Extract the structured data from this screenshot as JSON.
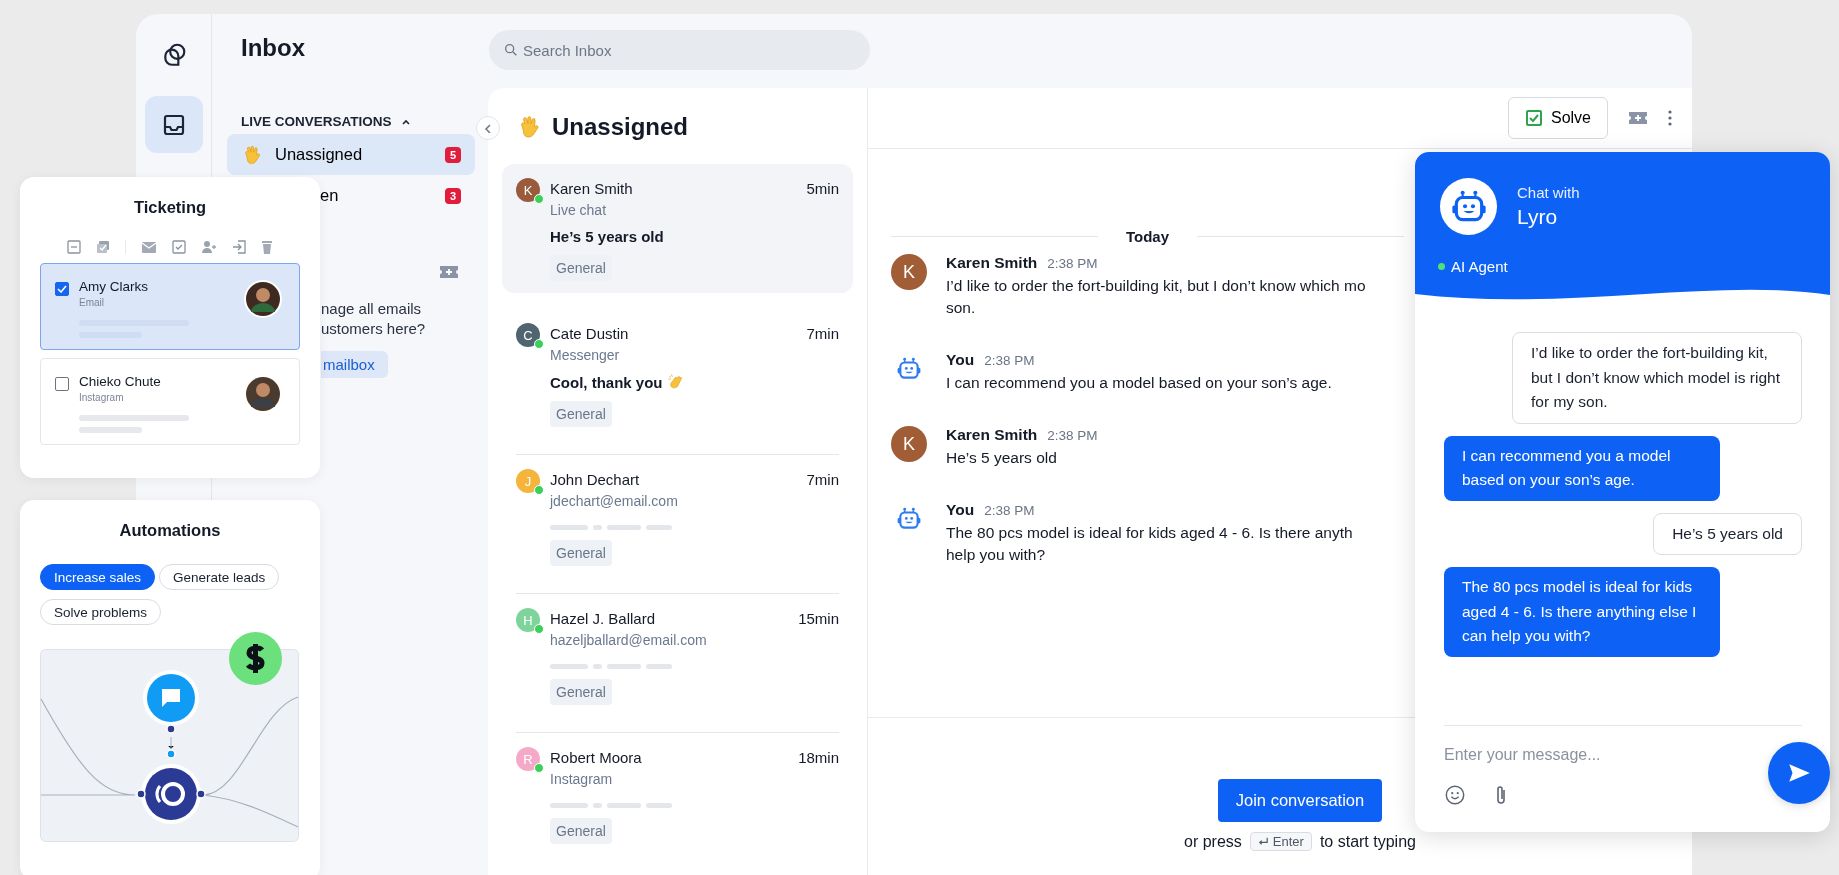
{
  "nav_rail": {
    "items": [
      {
        "kind": "logo",
        "selected": false
      },
      {
        "kind": "inbox",
        "selected": true
      }
    ]
  },
  "inbox_panel": {
    "title": "Inbox",
    "section": {
      "title": "LIVE CONVERSATIONS",
      "expanded": true
    },
    "folders": [
      {
        "kind": "emoji",
        "label": "Unassigned",
        "count": "5",
        "selected": true
      },
      {
        "kind": "partial",
        "label": "en",
        "count": "3",
        "selected": false
      }
    ],
    "prompt": {
      "text": "nage all emails\nustomers here?",
      "button": "mailbox"
    }
  },
  "search": {
    "placeholder": "Search Inbox"
  },
  "conversation_list": {
    "title": "Unassigned",
    "items": [
      {
        "kind": "preview",
        "initial": "K",
        "color": "#9a5b3c",
        "online": true,
        "name": "Karen Smith",
        "time": "5min",
        "channel": "Live chat",
        "preview": "He’s 5 years old",
        "tag": "General",
        "selected": true
      },
      {
        "kind": "emoji_preview",
        "initial": "C",
        "color": "#506570",
        "online": true,
        "name": "Cate Dustin",
        "time": "7min",
        "channel": "Messenger",
        "preview": "Cool, thank you",
        "tag": "General",
        "selected": false
      },
      {
        "kind": "placeholder",
        "initial": "J",
        "color": "#f5b43b",
        "online": true,
        "name": "John Dechart",
        "time": "7min",
        "channel": "jdechart@email.com",
        "tag": "General",
        "selected": false
      },
      {
        "kind": "placeholder",
        "initial": "H",
        "color": "#7fd49b",
        "online": true,
        "name": "Hazel J. Ballard",
        "time": "15min",
        "channel": "hazeljballard@email.com",
        "tag": "General",
        "selected": false
      },
      {
        "kind": "placeholder",
        "initial": "R",
        "color": "#f5a9c9",
        "online": true,
        "name": "Robert Moora",
        "time": "18min",
        "channel": "Instagram",
        "tag": "General",
        "selected": false
      }
    ]
  },
  "chat": {
    "solve": "Solve",
    "date": "Today",
    "messages": [
      {
        "kind": "customer",
        "initial": "K",
        "author": "Karen Smith",
        "time": "2:38 PM",
        "text": "I’d like to order the fort-building kit, but I don’t know which mo\nson."
      },
      {
        "kind": "bot",
        "author": "You",
        "time": "2:38 PM",
        "text": "I can recommend you a model based on your son’s age."
      },
      {
        "kind": "customer",
        "initial": "K",
        "author": "Karen Smith",
        "time": "2:38 PM",
        "text": "He’s 5 years old"
      },
      {
        "kind": "bot",
        "author": "You",
        "time": "2:38 PM",
        "text": "The 80 pcs model is ideal for kids aged 4 - 6. Is there anyth\nhelp you with?"
      }
    ],
    "join_button": "Join conversation",
    "hint_before": "or press",
    "hint_key": "Enter",
    "hint_after": "to start typing"
  },
  "widget": {
    "title": "Chat with",
    "name": "Lyro",
    "status": "AI Agent",
    "online": true,
    "messages": [
      {
        "kind": "user",
        "text": "I’d like to order the fort-building kit, but I don’t know which model is right for my son."
      },
      {
        "kind": "bot",
        "text": "I can recommend you a model based on your son’s age."
      },
      {
        "kind": "user",
        "text": "He’s 5 years old"
      },
      {
        "kind": "bot",
        "text": "The 80 pcs model is ideal for kids aged 4 - 6. Is there anything else I can help you with?"
      }
    ],
    "input": {
      "placeholder": "Enter your message..."
    }
  },
  "ticketing": {
    "title": "Ticketing",
    "tickets": [
      {
        "name": "Amy Clarks",
        "channel": "Email",
        "checked": true,
        "selected": true
      },
      {
        "name": "Chieko Chute",
        "channel": "Instagram",
        "checked": false,
        "selected": false
      }
    ]
  },
  "automations": {
    "title": "Automations",
    "chips": [
      {
        "label": "Increase sales",
        "selected": true
      },
      {
        "label": "Generate leads",
        "selected": false
      },
      {
        "label": "Solve problems",
        "selected": false
      }
    ]
  }
}
